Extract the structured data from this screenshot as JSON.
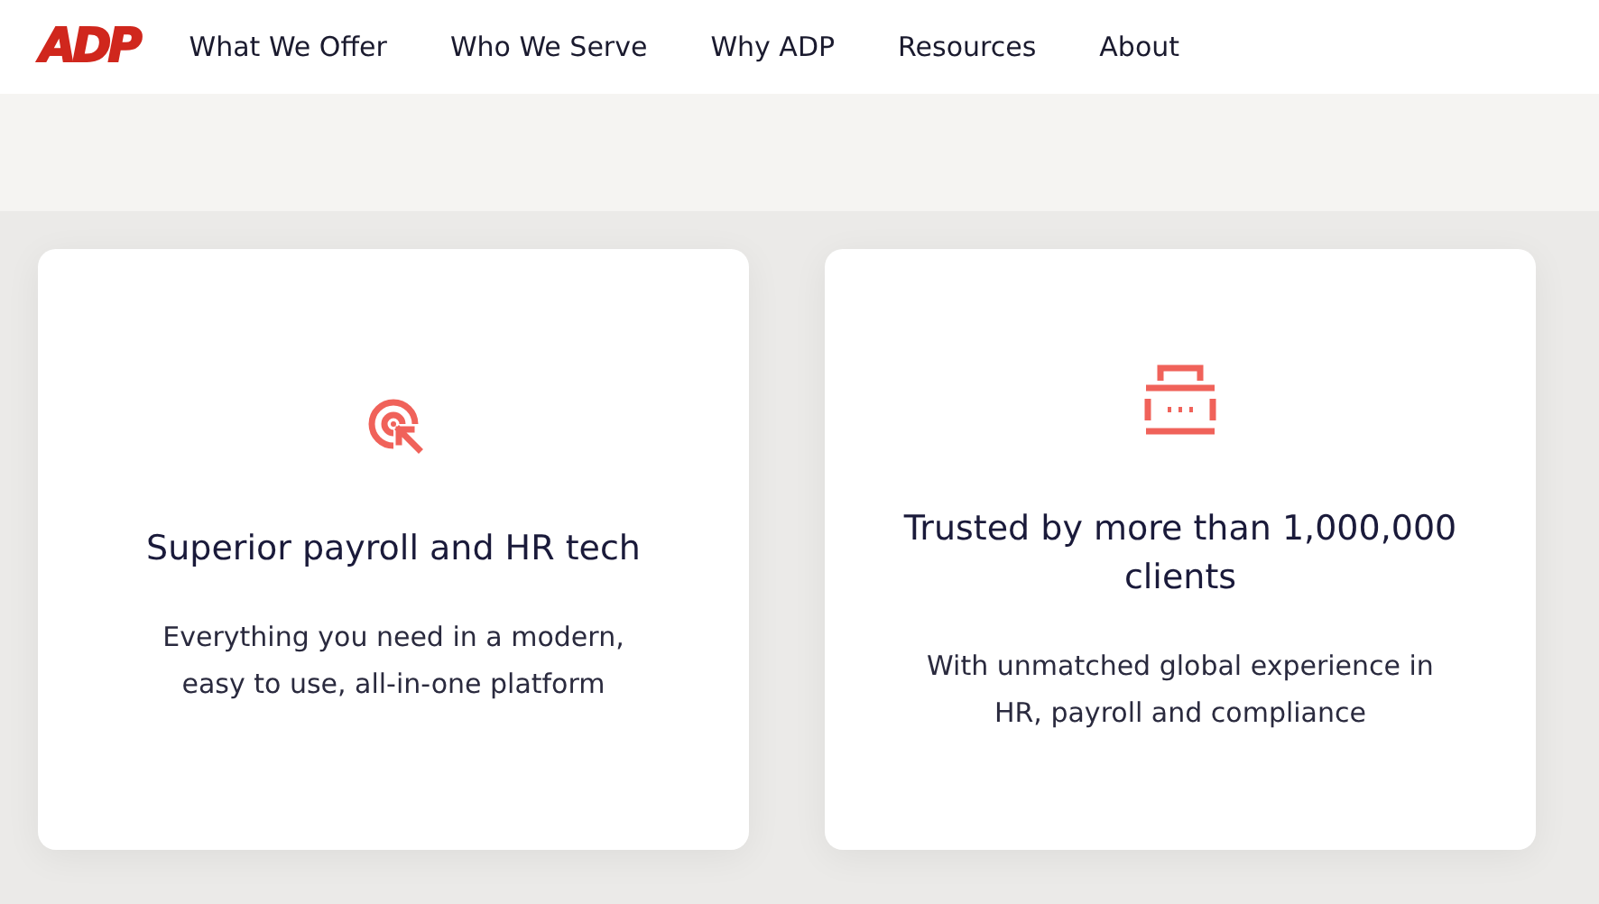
{
  "logo": "ADP",
  "nav": [
    "What We Offer",
    "Who We Serve",
    "Why ADP",
    "Resources",
    "About"
  ],
  "cards": [
    {
      "kind": "target",
      "title": "Superior payroll and HR tech",
      "description": "Everything you need in a modern, easy to use, all-in-one platform"
    },
    {
      "kind": "briefcase",
      "title": "Trusted by more than 1,000,000 clients",
      "description": "With unmatched global experience in HR, payroll and compliance"
    }
  ]
}
